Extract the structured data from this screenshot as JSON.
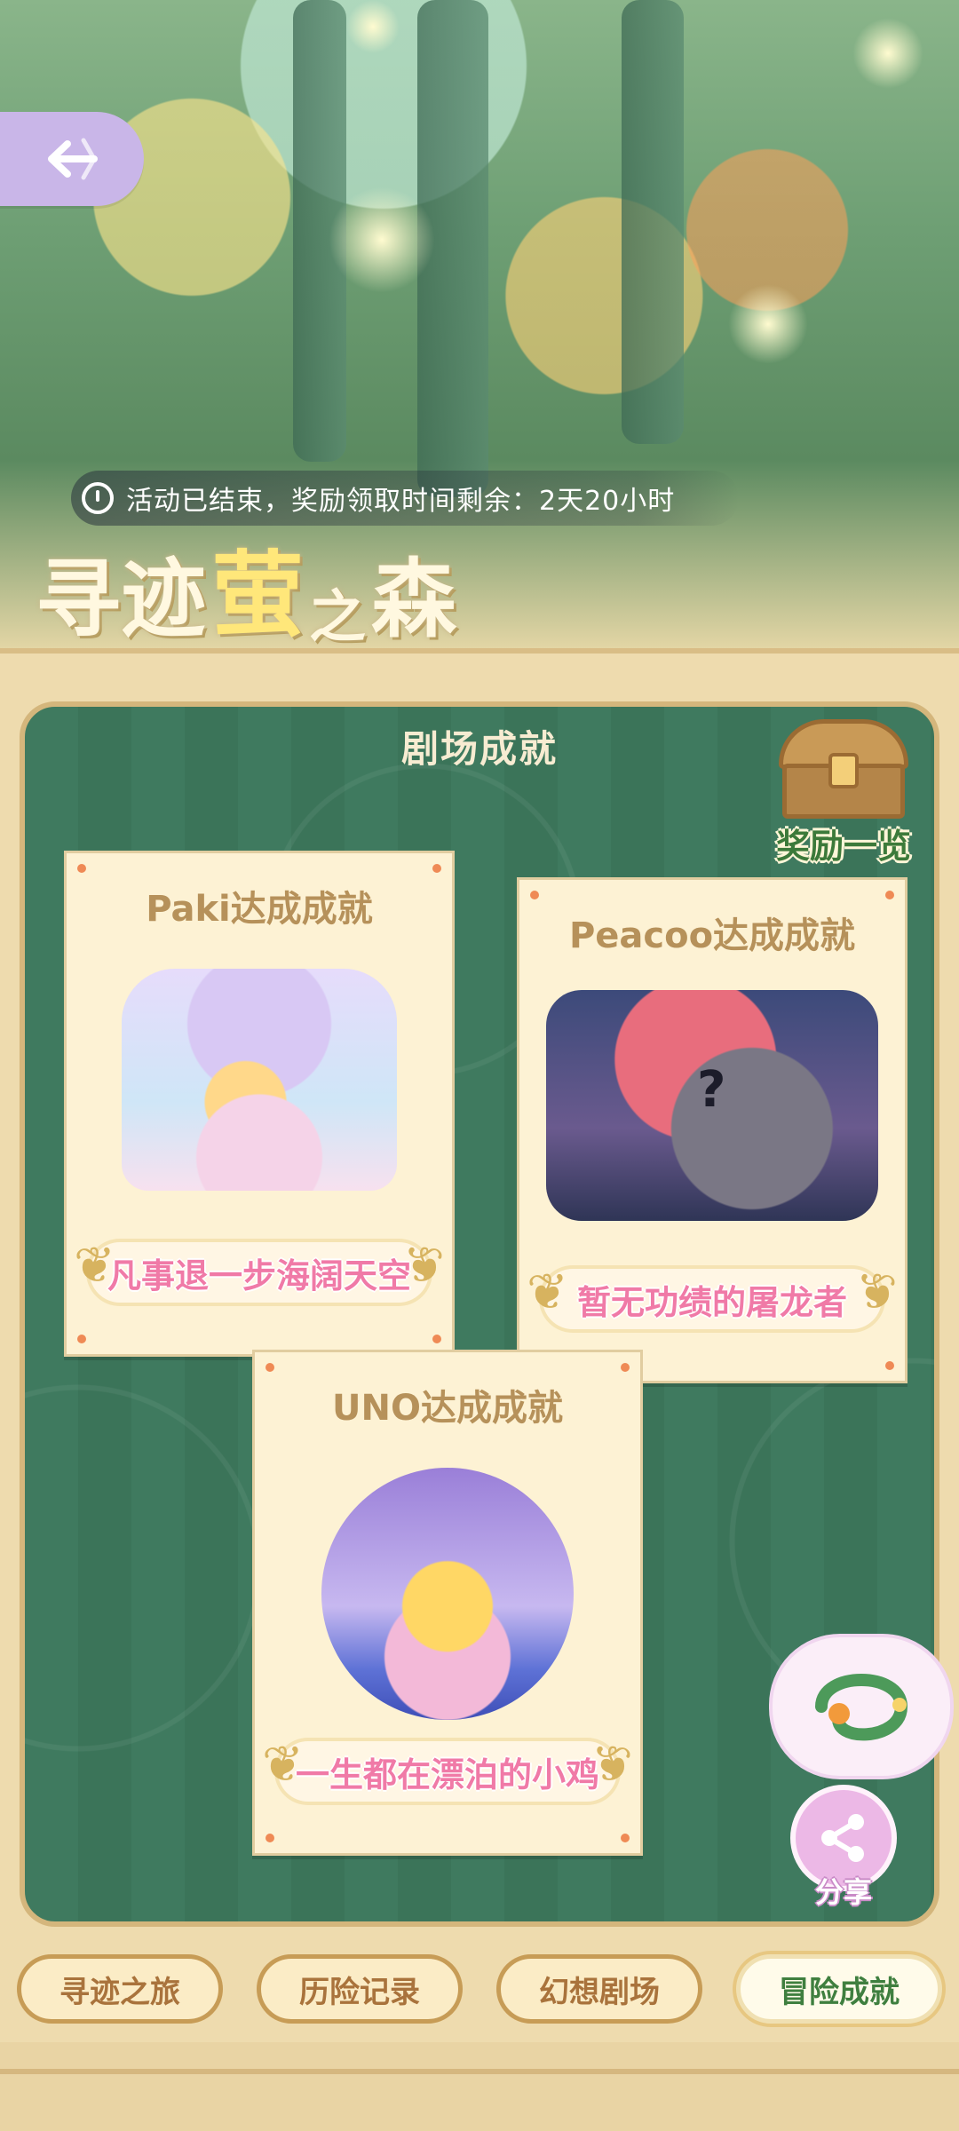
{
  "status": {
    "text": "活动已结束，奖励领取时间剩余：2天20小时"
  },
  "logo": {
    "part1": "寻迹",
    "part2": "萤",
    "part3": "之",
    "part4": "森"
  },
  "section": {
    "title": "剧场成就"
  },
  "reward": {
    "label": "奖励一览"
  },
  "cards": [
    {
      "title": "Paki达成成就",
      "badge": "凡事退一步海阔天空"
    },
    {
      "title": "Peacoo达成成就",
      "badge": "暂无功绩的屠龙者",
      "mark": "?"
    },
    {
      "title": "UNO达成成就",
      "badge": "一生都在漂泊的小鸡"
    }
  ],
  "share": {
    "label": "分享"
  },
  "nav": {
    "tabs": [
      {
        "label": "寻迹之旅",
        "active": false
      },
      {
        "label": "历险记录",
        "active": false
      },
      {
        "label": "幻想剧场",
        "active": false
      },
      {
        "label": "冒险成就",
        "active": true
      }
    ]
  }
}
